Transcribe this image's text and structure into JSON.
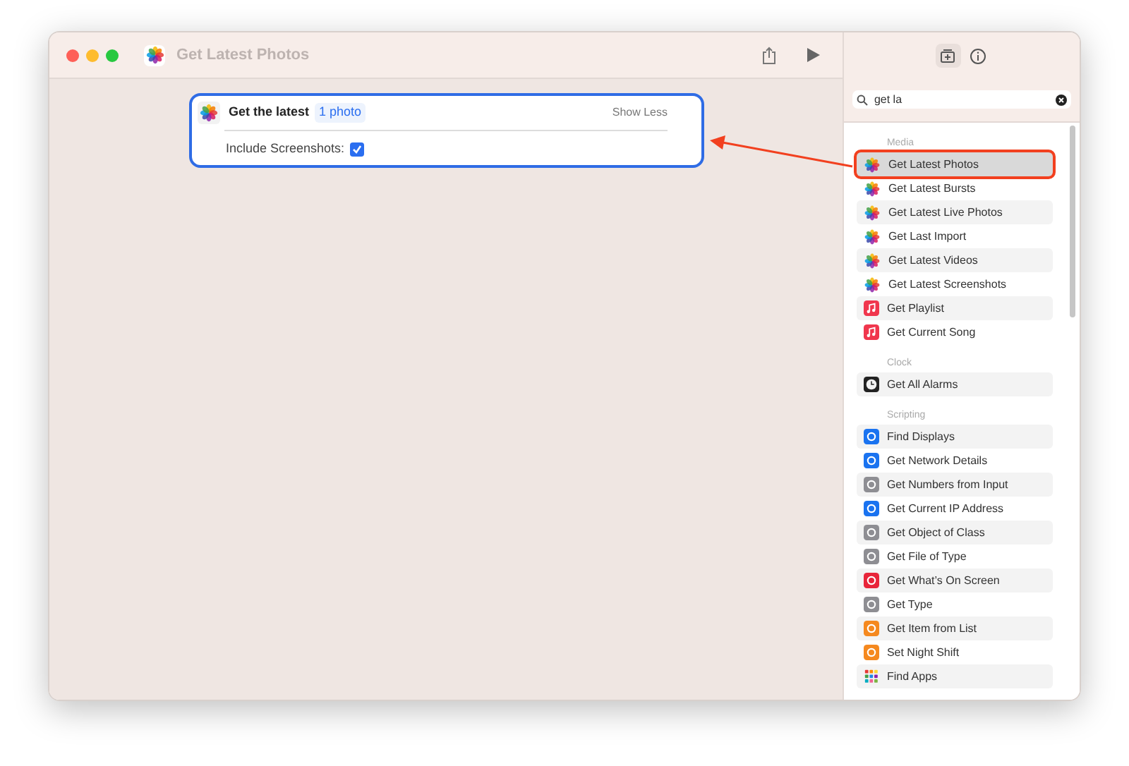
{
  "window": {
    "title": "Get Latest Photos"
  },
  "action_card": {
    "label": "Get the latest",
    "value": "1 photo",
    "toggle": "Show Less",
    "option_label": "Include Screenshots:",
    "include_screenshots": true
  },
  "search": {
    "value": "get la"
  },
  "sections": [
    {
      "title": "Media",
      "items": [
        {
          "label": "Get Latest Photos",
          "kind": "photos",
          "selected": true
        },
        {
          "label": "Get Latest Bursts",
          "kind": "photos",
          "selected": false
        },
        {
          "label": "Get Latest Live Photos",
          "kind": "photos",
          "selected": false
        },
        {
          "label": "Get Last Import",
          "kind": "photos",
          "selected": false
        },
        {
          "label": "Get Latest Videos",
          "kind": "photos",
          "selected": false
        },
        {
          "label": "Get Latest Screenshots",
          "kind": "photos",
          "selected": false
        },
        {
          "label": "Get Playlist",
          "kind": "music",
          "selected": false
        },
        {
          "label": "Get Current Song",
          "kind": "music",
          "selected": false
        }
      ]
    },
    {
      "title": "Clock",
      "items": [
        {
          "label": "Get All Alarms",
          "kind": "clock",
          "selected": false
        }
      ]
    },
    {
      "title": "Scripting",
      "items": [
        {
          "label": "Find Displays",
          "kind": "tile",
          "color": "#1a73f0",
          "selected": false
        },
        {
          "label": "Get Network Details",
          "kind": "tile",
          "color": "#1a73f0",
          "selected": false
        },
        {
          "label": "Get Numbers from Input",
          "kind": "tile",
          "color": "#8e8e93",
          "selected": false
        },
        {
          "label": "Get Current IP Address",
          "kind": "tile",
          "color": "#1a73f0",
          "selected": false
        },
        {
          "label": "Get Object of Class",
          "kind": "tile",
          "color": "#8e8e93",
          "selected": false
        },
        {
          "label": "Get File of Type",
          "kind": "tile",
          "color": "#8e8e93",
          "selected": false
        },
        {
          "label": "Get What’s On Screen",
          "kind": "tile",
          "color": "#e8253a",
          "selected": false
        },
        {
          "label": "Get Type",
          "kind": "tile",
          "color": "#8e8e93",
          "selected": false
        },
        {
          "label": "Get Item from List",
          "kind": "tile",
          "color": "#f5891f",
          "selected": false
        },
        {
          "label": "Set Night Shift",
          "kind": "tile",
          "color": "#f5891f",
          "selected": false
        },
        {
          "label": "Find Apps",
          "kind": "grid",
          "selected": false
        }
      ]
    }
  ]
}
